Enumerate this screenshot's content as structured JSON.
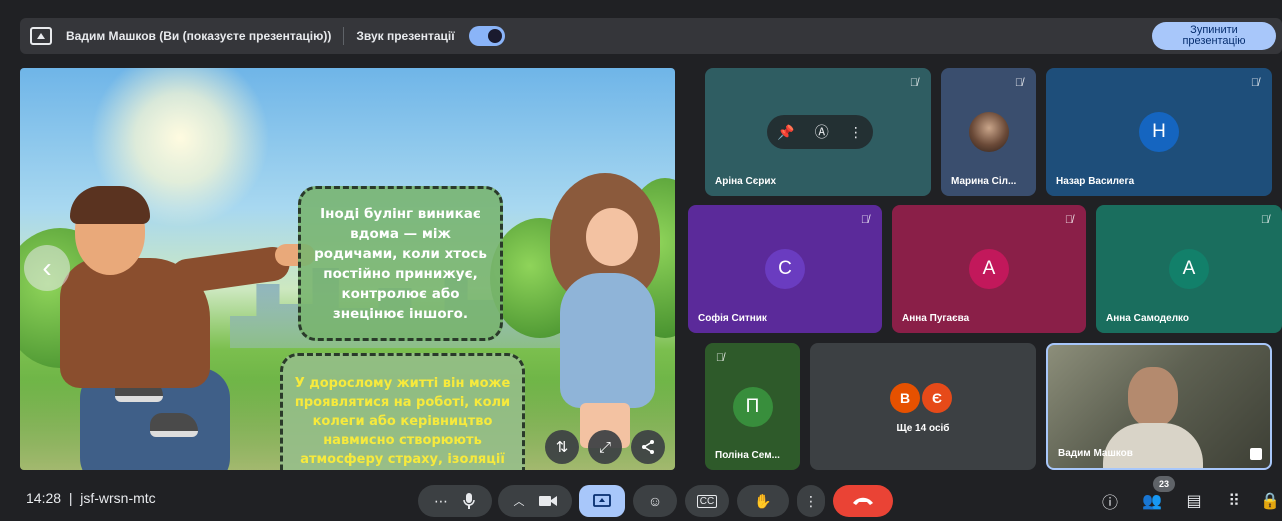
{
  "topbar": {
    "presenter_text": "Вадим Машков (Ви (показуєте презентацію))",
    "sound_label": "Звук презентації",
    "sound_on": true,
    "stop_button": "Зупинити презентацію"
  },
  "slide": {
    "bubble1": "Іноді булінг виникає вдома — між родичами, коли хтось постійно принижує, контролює або знецінює іншого.",
    "bubble2": "У дорослому житті він може проявлятися на роботі, коли колеги або керівництво навмисно створюють атмосферу страху, ізоляції чи несправедливості.",
    "controls": [
      "fit-icon",
      "expand-icon",
      "share-icon"
    ]
  },
  "nav": {
    "prev": "‹",
    "next": "›"
  },
  "participants": [
    {
      "name": "Аріна Сєрих",
      "initial": "",
      "color": "#2f5d62",
      "muted": true
    },
    {
      "name": "Марина Сіл...",
      "initial": "",
      "color": "#3a4e6e",
      "muted": true
    },
    {
      "name": "Назар Василега",
      "initial": "Н",
      "color": "#1e4e7a",
      "avatar_color": "#1565c0",
      "muted": true
    },
    {
      "name": "Софія Ситник",
      "initial": "С",
      "color": "#5b2a9a",
      "avatar_color": "#6a3cc0",
      "muted": true
    },
    {
      "name": "Анна Пугаєва",
      "initial": "А",
      "color": "#8a1f48",
      "avatar_color": "#c2185b",
      "muted": true
    },
    {
      "name": "Анна Самоделко",
      "initial": "А",
      "color": "#1a6e5e",
      "avatar_color": "#12806a",
      "muted": true
    },
    {
      "name": "Поліна Сем...",
      "initial": "П",
      "color": "#2e5a2a",
      "avatar_color": "#388e3c",
      "muted": true
    },
    {
      "name": "Вадим Машков",
      "initial": "",
      "color": "#6b6d5e",
      "muted": false
    }
  ],
  "others": {
    "label": "Ще 14 осіб",
    "avatars": [
      {
        "initial": "В",
        "color": "#e65100"
      },
      {
        "initial": "Є",
        "color": "#e64a19"
      }
    ]
  },
  "bottom": {
    "time": "14:28",
    "meeting_code": "jsf-wrsn-mtc",
    "participants_count": "23"
  },
  "colors": {
    "accent": "#a8c7fa",
    "end_call": "#ea4335",
    "present_active": "#a8c7fa"
  }
}
